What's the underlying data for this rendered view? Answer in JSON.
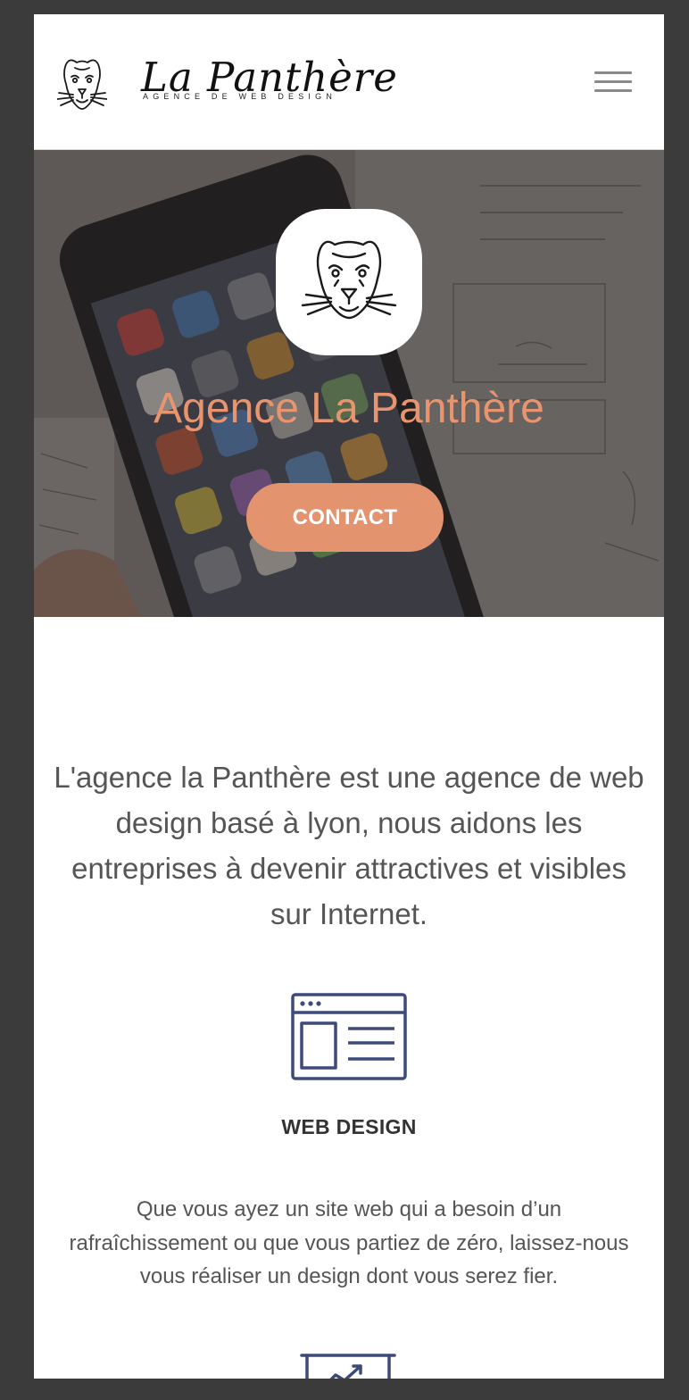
{
  "header": {
    "brand_name": "La Panthère",
    "tagline": "AGENCE DE WEB DESIGN",
    "logo_icon": "panther-head-icon",
    "menu_icon": "hamburger-menu-icon"
  },
  "hero": {
    "badge_icon": "panther-head-icon",
    "title": "Agence La Panthère",
    "cta_label": "CONTACT"
  },
  "intro": {
    "text": "L'agence la Panthère est une agence de web design basé à lyon, nous aidons les entreprises à devenir attractives et visibles sur Internet."
  },
  "services": [
    {
      "icon": "web-layout-icon",
      "title": "WEB DESIGN",
      "description": "Que vous ayez un site web qui a besoin d’un rafraîchissement ou que vous partiez de zéro, laissez-nous vous réaliser un design dont vous serez fier."
    },
    {
      "icon": "chart-board-icon"
    }
  ],
  "colors": {
    "accent": "#e3936e",
    "title_accent": "#e8956f",
    "icon_navy": "#3d4a7a",
    "text_gray": "#555555",
    "page_bg": "#3b3b3b"
  }
}
